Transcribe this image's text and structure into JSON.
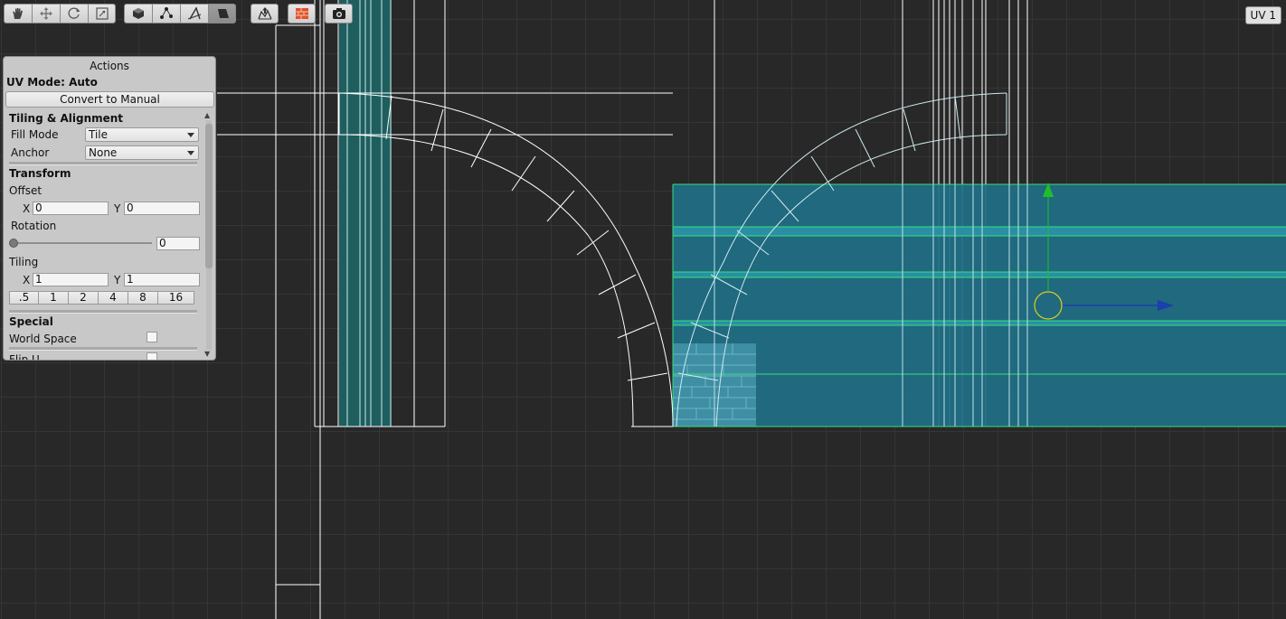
{
  "toolbar": {
    "tool_icons": [
      "hand-icon",
      "move-icon",
      "rotate-icon",
      "scale-icon"
    ],
    "select_icons": [
      "object-mode-icon",
      "vertex-mode-icon",
      "edge-mode-icon",
      "face-mode-icon"
    ],
    "active_select": "face-mode-icon",
    "extra_icons": [
      "uv-export-icon",
      "texture-group-icon",
      "screenshot-icon"
    ]
  },
  "uv_channel": "UV 1",
  "actions": {
    "title": "Actions",
    "uv_mode": "UV Mode: Auto",
    "convert_button": "Convert to Manual",
    "tiling_alignment": {
      "header": "Tiling & Alignment",
      "fill_mode_label": "Fill Mode",
      "fill_mode_value": "Tile",
      "anchor_label": "Anchor",
      "anchor_value": "None"
    },
    "transform": {
      "header": "Transform",
      "offset_label": "Offset",
      "offset_x_label": "X",
      "offset_x": "0",
      "offset_y_label": "Y",
      "offset_y": "0",
      "rotation_label": "Rotation",
      "rotation_value": "0",
      "tiling_label": "Tiling",
      "tiling_x_label": "X",
      "tiling_x": "1",
      "tiling_y_label": "Y",
      "tiling_y": "1",
      "tiling_presets": [
        ".5",
        "1",
        "2",
        "4",
        "8",
        "16"
      ]
    },
    "special": {
      "header": "Special",
      "world_space_label": "World Space",
      "world_space_checked": false,
      "flip_u_label": "Flip U"
    }
  },
  "colors": {
    "background": "#282828",
    "grid": "#353535",
    "selection_fill": "#1f6f86",
    "selection_edge": "#35e07a",
    "wire": "#ffffff",
    "gizmo_y": "#1fbf2a",
    "gizmo_x": "#1b3fae",
    "gizmo_center": "#d9d21f",
    "texture_group_icon": "#e2512a"
  }
}
